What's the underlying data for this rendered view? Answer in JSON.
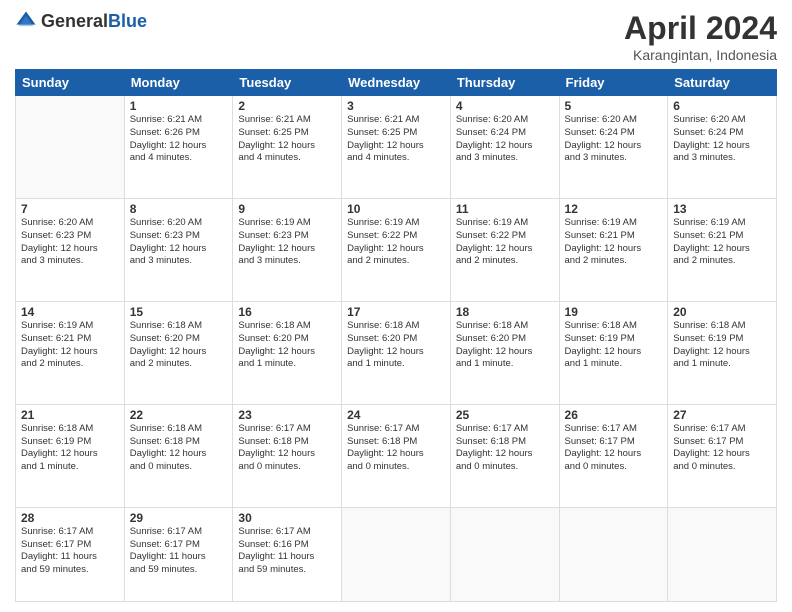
{
  "header": {
    "logo_general": "General",
    "logo_blue": "Blue",
    "title": "April 2024",
    "location": "Karangintan, Indonesia"
  },
  "days_of_week": [
    "Sunday",
    "Monday",
    "Tuesday",
    "Wednesday",
    "Thursday",
    "Friday",
    "Saturday"
  ],
  "weeks": [
    [
      {
        "day": "",
        "info": ""
      },
      {
        "day": "1",
        "info": "Sunrise: 6:21 AM\nSunset: 6:26 PM\nDaylight: 12 hours\nand 4 minutes."
      },
      {
        "day": "2",
        "info": "Sunrise: 6:21 AM\nSunset: 6:25 PM\nDaylight: 12 hours\nand 4 minutes."
      },
      {
        "day": "3",
        "info": "Sunrise: 6:21 AM\nSunset: 6:25 PM\nDaylight: 12 hours\nand 4 minutes."
      },
      {
        "day": "4",
        "info": "Sunrise: 6:20 AM\nSunset: 6:24 PM\nDaylight: 12 hours\nand 3 minutes."
      },
      {
        "day": "5",
        "info": "Sunrise: 6:20 AM\nSunset: 6:24 PM\nDaylight: 12 hours\nand 3 minutes."
      },
      {
        "day": "6",
        "info": "Sunrise: 6:20 AM\nSunset: 6:24 PM\nDaylight: 12 hours\nand 3 minutes."
      }
    ],
    [
      {
        "day": "7",
        "info": "Sunrise: 6:20 AM\nSunset: 6:23 PM\nDaylight: 12 hours\nand 3 minutes."
      },
      {
        "day": "8",
        "info": "Sunrise: 6:20 AM\nSunset: 6:23 PM\nDaylight: 12 hours\nand 3 minutes."
      },
      {
        "day": "9",
        "info": "Sunrise: 6:19 AM\nSunset: 6:23 PM\nDaylight: 12 hours\nand 3 minutes."
      },
      {
        "day": "10",
        "info": "Sunrise: 6:19 AM\nSunset: 6:22 PM\nDaylight: 12 hours\nand 2 minutes."
      },
      {
        "day": "11",
        "info": "Sunrise: 6:19 AM\nSunset: 6:22 PM\nDaylight: 12 hours\nand 2 minutes."
      },
      {
        "day": "12",
        "info": "Sunrise: 6:19 AM\nSunset: 6:21 PM\nDaylight: 12 hours\nand 2 minutes."
      },
      {
        "day": "13",
        "info": "Sunrise: 6:19 AM\nSunset: 6:21 PM\nDaylight: 12 hours\nand 2 minutes."
      }
    ],
    [
      {
        "day": "14",
        "info": "Sunrise: 6:19 AM\nSunset: 6:21 PM\nDaylight: 12 hours\nand 2 minutes."
      },
      {
        "day": "15",
        "info": "Sunrise: 6:18 AM\nSunset: 6:20 PM\nDaylight: 12 hours\nand 2 minutes."
      },
      {
        "day": "16",
        "info": "Sunrise: 6:18 AM\nSunset: 6:20 PM\nDaylight: 12 hours\nand 1 minute."
      },
      {
        "day": "17",
        "info": "Sunrise: 6:18 AM\nSunset: 6:20 PM\nDaylight: 12 hours\nand 1 minute."
      },
      {
        "day": "18",
        "info": "Sunrise: 6:18 AM\nSunset: 6:20 PM\nDaylight: 12 hours\nand 1 minute."
      },
      {
        "day": "19",
        "info": "Sunrise: 6:18 AM\nSunset: 6:19 PM\nDaylight: 12 hours\nand 1 minute."
      },
      {
        "day": "20",
        "info": "Sunrise: 6:18 AM\nSunset: 6:19 PM\nDaylight: 12 hours\nand 1 minute."
      }
    ],
    [
      {
        "day": "21",
        "info": "Sunrise: 6:18 AM\nSunset: 6:19 PM\nDaylight: 12 hours\nand 1 minute."
      },
      {
        "day": "22",
        "info": "Sunrise: 6:18 AM\nSunset: 6:18 PM\nDaylight: 12 hours\nand 0 minutes."
      },
      {
        "day": "23",
        "info": "Sunrise: 6:17 AM\nSunset: 6:18 PM\nDaylight: 12 hours\nand 0 minutes."
      },
      {
        "day": "24",
        "info": "Sunrise: 6:17 AM\nSunset: 6:18 PM\nDaylight: 12 hours\nand 0 minutes."
      },
      {
        "day": "25",
        "info": "Sunrise: 6:17 AM\nSunset: 6:18 PM\nDaylight: 12 hours\nand 0 minutes."
      },
      {
        "day": "26",
        "info": "Sunrise: 6:17 AM\nSunset: 6:17 PM\nDaylight: 12 hours\nand 0 minutes."
      },
      {
        "day": "27",
        "info": "Sunrise: 6:17 AM\nSunset: 6:17 PM\nDaylight: 12 hours\nand 0 minutes."
      }
    ],
    [
      {
        "day": "28",
        "info": "Sunrise: 6:17 AM\nSunset: 6:17 PM\nDaylight: 11 hours\nand 59 minutes."
      },
      {
        "day": "29",
        "info": "Sunrise: 6:17 AM\nSunset: 6:17 PM\nDaylight: 11 hours\nand 59 minutes."
      },
      {
        "day": "30",
        "info": "Sunrise: 6:17 AM\nSunset: 6:16 PM\nDaylight: 11 hours\nand 59 minutes."
      },
      {
        "day": "",
        "info": ""
      },
      {
        "day": "",
        "info": ""
      },
      {
        "day": "",
        "info": ""
      },
      {
        "day": "",
        "info": ""
      }
    ]
  ]
}
